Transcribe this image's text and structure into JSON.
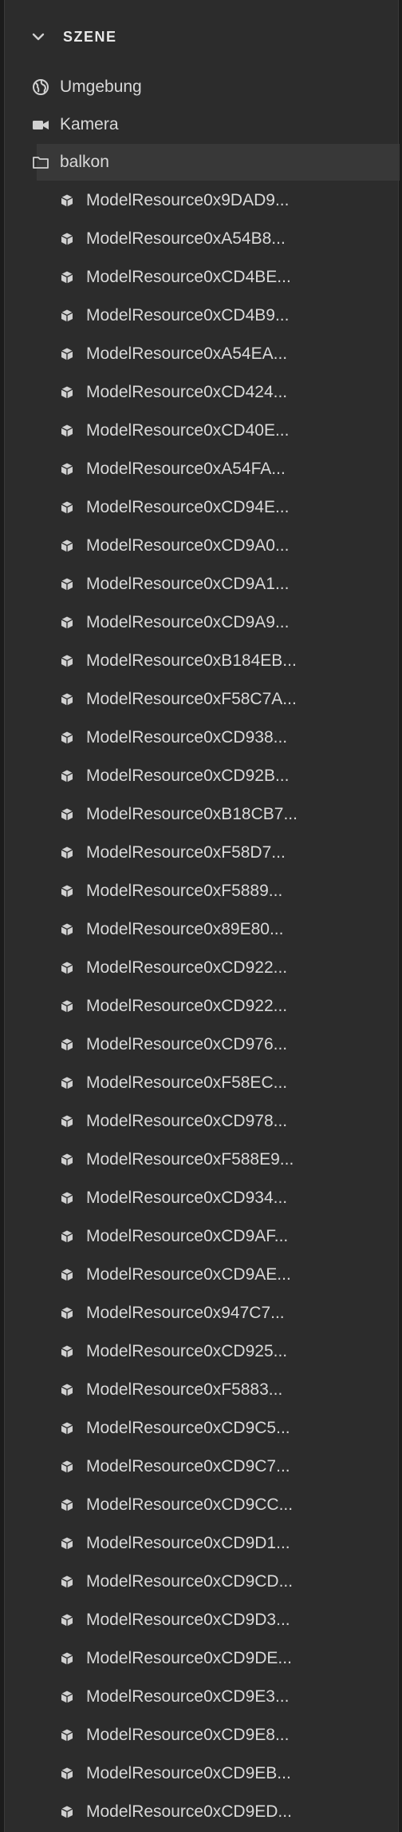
{
  "panel": {
    "title": "SZENE",
    "top_items": [
      {
        "label": "Umgebung",
        "icon": "globe-icon"
      },
      {
        "label": "Kamera",
        "icon": "camera-icon"
      },
      {
        "label": "balkon",
        "icon": "folder-icon"
      }
    ],
    "children": [
      "ModelResource0x9DAD9...",
      "ModelResource0xA54B8...",
      "ModelResource0xCD4BE...",
      "ModelResource0xCD4B9...",
      "ModelResource0xA54EA...",
      "ModelResource0xCD424...",
      "ModelResource0xCD40E...",
      "ModelResource0xA54FA...",
      "ModelResource0xCD94E...",
      "ModelResource0xCD9A0...",
      "ModelResource0xCD9A1...",
      "ModelResource0xCD9A9...",
      "ModelResource0xB184EB...",
      "ModelResource0xF58C7A...",
      "ModelResource0xCD938...",
      "ModelResource0xCD92B...",
      "ModelResource0xB18CB7...",
      "ModelResource0xF58D7...",
      "ModelResource0xF5889...",
      "ModelResource0x89E80...",
      "ModelResource0xCD922...",
      "ModelResource0xCD922...",
      "ModelResource0xCD976...",
      "ModelResource0xF58EC...",
      "ModelResource0xCD978...",
      "ModelResource0xF588E9...",
      "ModelResource0xCD934...",
      "ModelResource0xCD9AF...",
      "ModelResource0xCD9AE...",
      "ModelResource0x947C7...",
      "ModelResource0xCD925...",
      "ModelResource0xF5883...",
      "ModelResource0xCD9C5...",
      "ModelResource0xCD9C7...",
      "ModelResource0xCD9CC...",
      "ModelResource0xCD9D1...",
      "ModelResource0xCD9CD...",
      "ModelResource0xCD9D3...",
      "ModelResource0xCD9DE...",
      "ModelResource0xCD9E3...",
      "ModelResource0xCD9E8...",
      "ModelResource0xCD9EB...",
      "ModelResource0xCD9ED..."
    ],
    "child_icon": "cube-icon",
    "selected_index": 2
  }
}
